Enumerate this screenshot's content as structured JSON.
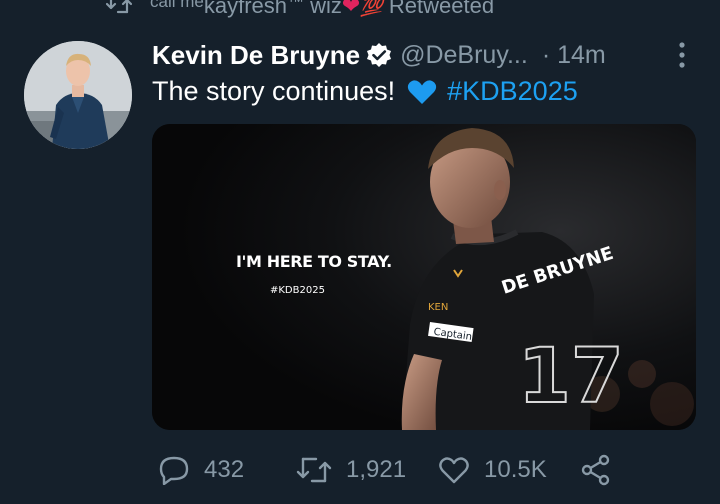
{
  "retweet_context": {
    "name_small": "call me",
    "name_main": "kayfresh",
    "name_tm": "™",
    "name_tail": " wiz",
    "heart": "❤",
    "hundred": "💯",
    "label": "Retweeted"
  },
  "tweet": {
    "display_name": "Kevin De Bruyne",
    "handle": "@DeBruy...",
    "time": "· 14m",
    "text": "The story continues!",
    "hashtag": "#KDB2025",
    "media": {
      "caption": "I'M HERE TO STAY.",
      "tag": "#KDB2025",
      "jersey_name": "DE BRUYNE",
      "jersey_number": "17",
      "armband": "Captain"
    }
  },
  "actions": {
    "replies": "432",
    "retweets": "1,921",
    "likes": "10.5K"
  },
  "colors": {
    "background": "#15202b",
    "secondary_text": "#8899a6",
    "link": "#1da1f2",
    "heart_blue": "#1d9bf0"
  }
}
